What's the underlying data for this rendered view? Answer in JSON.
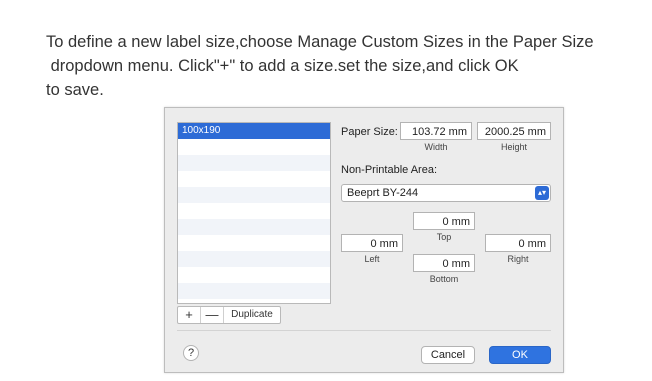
{
  "instructions": {
    "line1": "To define a new label size,choose Manage Custom Sizes in the Paper Size",
    "line2": " dropdown menu. Click\"+\" to add a size.set the size,and click OK",
    "line3": "to save."
  },
  "dialog": {
    "sizes": [
      "100x190"
    ],
    "list_buttons": {
      "add": "+",
      "remove": "—",
      "duplicate": "Duplicate"
    },
    "paper_size_label": "Paper Size:",
    "width_value": "103.72 mm",
    "width_label": "Width",
    "height_value": "2000.25 mm",
    "height_label": "Height",
    "non_printable_label": "Non-Printable Area:",
    "printer_selected": "Beeprt BY-244",
    "top_value": "0 mm",
    "top_label": "Top",
    "left_value": "0 mm",
    "left_label": "Left",
    "right_value": "0 mm",
    "right_label": "Right",
    "bottom_value": "0 mm",
    "bottom_label": "Bottom",
    "help_label": "?",
    "cancel_label": "Cancel",
    "ok_label": "OK",
    "colors": {
      "accent": "#2d6bd6",
      "ok_button": "#2f73e0"
    }
  }
}
